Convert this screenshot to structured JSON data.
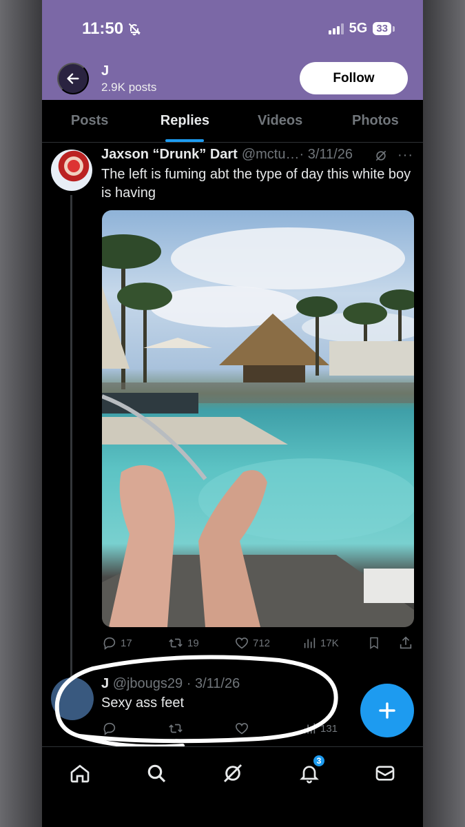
{
  "status_bar": {
    "time": "11:50",
    "network": "5G",
    "battery": "33"
  },
  "header": {
    "name": "J",
    "posts": "2.9K posts",
    "follow_label": "Follow"
  },
  "tabs": [
    {
      "label": "Posts",
      "active": false
    },
    {
      "label": "Replies",
      "active": true
    },
    {
      "label": "Videos",
      "active": false
    },
    {
      "label": "Photos",
      "active": false
    }
  ],
  "tweet1": {
    "name": "Jaxson “Drunk” Dart",
    "handle": "@mctu…",
    "date": "· 3/11/26",
    "text": "The left is fuming abt the type of day this white boy is having",
    "replies": "17",
    "reposts": "19",
    "likes": "712",
    "views": "17K"
  },
  "tweet2": {
    "name": "J",
    "handle": "@jbougs29",
    "date": "· 3/11/26",
    "text": "Sexy ass feet",
    "views": "131"
  },
  "nav": {
    "notifications_badge": "3"
  },
  "colors": {
    "header_bg": "#7b68a6",
    "accent": "#1d9bf0",
    "muted": "#71767b",
    "text": "#e7e9ea"
  }
}
